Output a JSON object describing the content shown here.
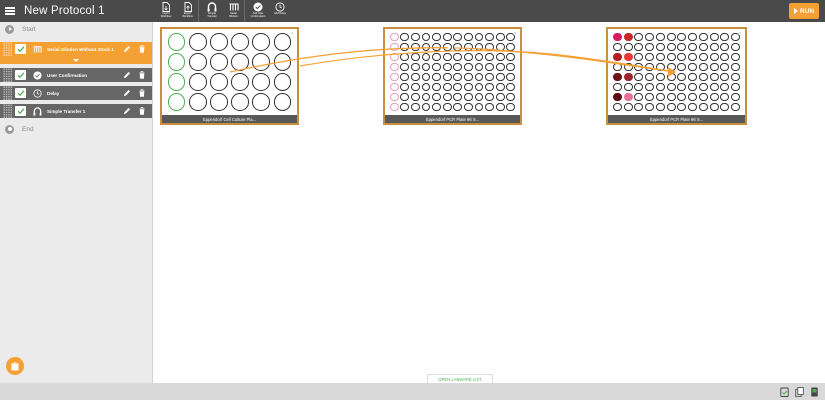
{
  "header": {
    "title": "New Protocol 1",
    "tools": [
      {
        "name": "import-workflow",
        "label": "Import\nWorkflow",
        "icon": "file-import-icon"
      },
      {
        "name": "export-workflow",
        "label": "Export\nWorkflow",
        "icon": "file-export-icon"
      },
      {
        "name": "simple-transfer",
        "label": "Simple\nTransfer",
        "icon": "simple-transfer-icon"
      },
      {
        "name": "serial-dilution",
        "label": "Serial\nDilution",
        "icon": "serial-dilution-icon"
      },
      {
        "name": "add-user-confirmation",
        "label": "Add User\nConfirmation",
        "icon": "check-circle-icon"
      },
      {
        "name": "add-delay",
        "label": "Add Delay",
        "icon": "clock-icon"
      }
    ],
    "run_label": "RUN"
  },
  "sidebar": {
    "start_label": "Start",
    "end_label": "End",
    "steps": [
      {
        "label": "Serial Dilution Without Stock 1",
        "icon": "serial-dilution-icon",
        "active": true,
        "checked": true
      },
      {
        "label": "User Confirmation",
        "icon": "check-circle-icon",
        "active": false,
        "checked": true
      },
      {
        "label": "Delay",
        "icon": "clock-icon",
        "active": false,
        "checked": true
      },
      {
        "label": "Simple Transfer 1",
        "icon": "simple-transfer-icon",
        "active": false,
        "checked": true
      }
    ]
  },
  "labware": [
    {
      "label": "Eppendorf Cell Culture Pla...",
      "rows": 4,
      "cols": 6,
      "source_columns": [
        0
      ]
    },
    {
      "label": "Eppendorf PCR Plate 96 S...",
      "rows": 8,
      "cols": 12,
      "light_columns": [
        0
      ]
    },
    {
      "label": "Eppendorf PCR Plate 96 S...",
      "rows": 8,
      "cols": 12,
      "filled_wells": [
        {
          "row": 0,
          "col": 0,
          "color": "#d81b60"
        },
        {
          "row": 0,
          "col": 1,
          "color": "#c62828"
        },
        {
          "row": 2,
          "col": 0,
          "color": "#b71c1c"
        },
        {
          "row": 2,
          "col": 1,
          "color": "#e53935"
        },
        {
          "row": 4,
          "col": 0,
          "color": "#6d1216"
        },
        {
          "row": 4,
          "col": 1,
          "color": "#9c2430"
        },
        {
          "row": 6,
          "col": 0,
          "color": "#5a0e12"
        },
        {
          "row": 6,
          "col": 1,
          "color": "#e57394"
        }
      ]
    }
  ],
  "footer": {
    "labware_list_label": "OPEN LABWARE LIST",
    "icons": [
      "clipboard-check-icon",
      "copy-icon",
      "device-icon"
    ]
  },
  "colors": {
    "header": "#4a4a4a",
    "accent": "#f5a033",
    "step": "#666666",
    "plate_border": "#c98f3c",
    "transfer_line": "#f5a033",
    "source_well": "#4caf50",
    "light_well": "#e8a0b8"
  }
}
